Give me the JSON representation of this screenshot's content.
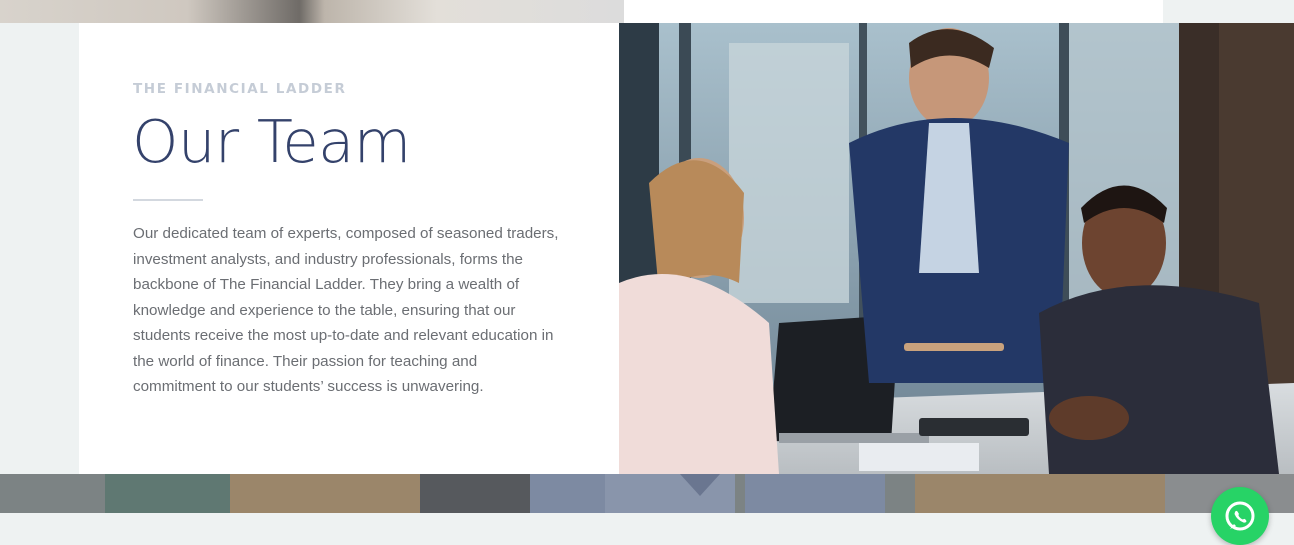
{
  "section": {
    "eyebrow": "THE FINANCIAL LADDER",
    "title": "Our Team",
    "description": "Our dedicated team of experts, composed of seasoned traders, investment analysts, and industry professionals, forms the backbone of The Financial Ladder. They bring a wealth of knowledge and experience to the table, ensuring that our students receive the most up-to-date and relevant education in the world of finance. Their passion for teaching and commitment to our students’ success is unwavering."
  },
  "colors": {
    "page_background": "#eef2f2",
    "title": "#34426b",
    "eyebrow": "#c5ccd6",
    "body_text": "#6b6e73",
    "whatsapp": "#27d366"
  },
  "icons": {
    "floating_action": "whatsapp-icon"
  }
}
